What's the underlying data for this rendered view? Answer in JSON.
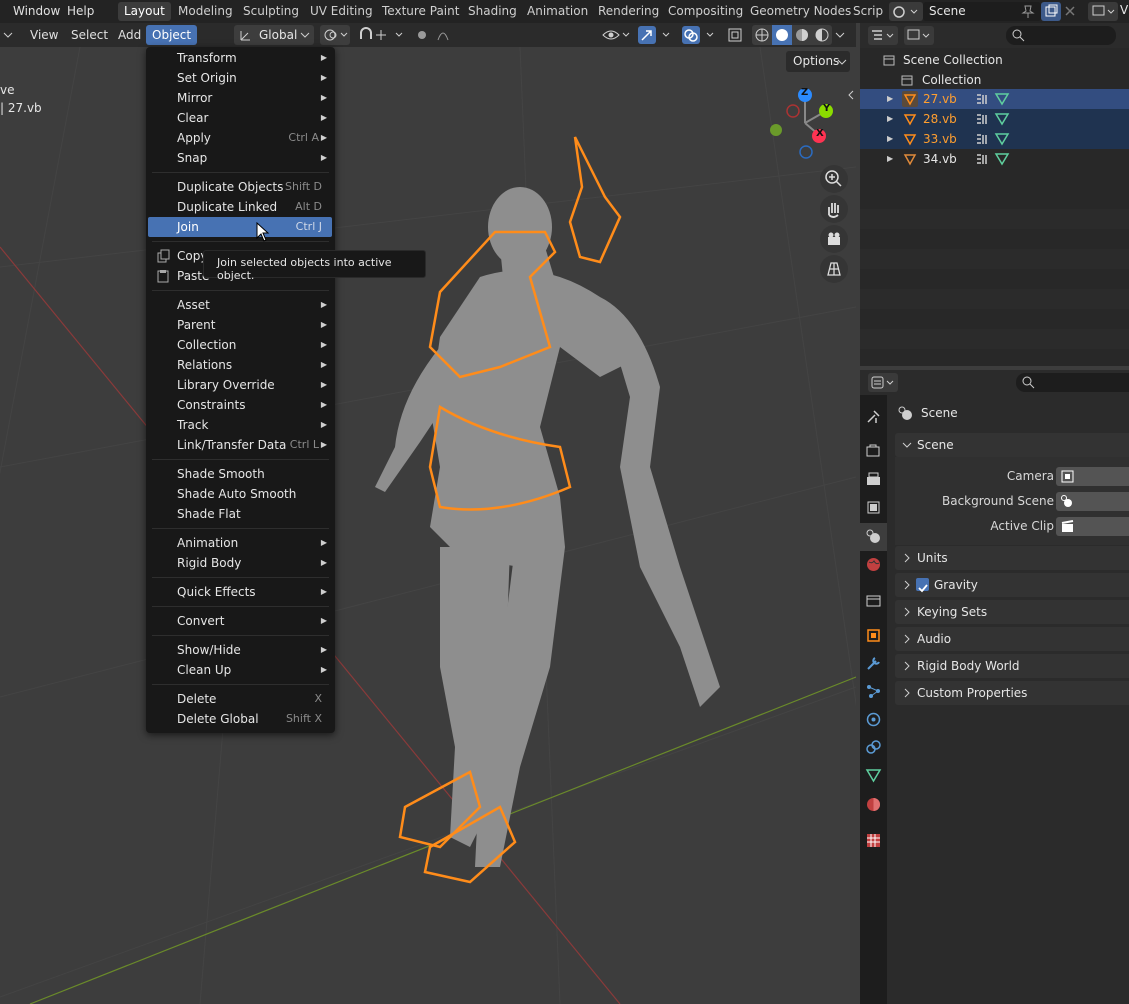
{
  "topbar": {
    "menus": [
      "Window",
      "Help"
    ],
    "workspaces": [
      "Layout",
      "Modeling",
      "Sculpting",
      "UV Editing",
      "Texture Paint",
      "Shading",
      "Animation",
      "Rendering",
      "Compositing",
      "Geometry Nodes",
      "Scrip"
    ],
    "active_workspace": "Layout",
    "scene_name": "Scene",
    "view_layer_initial": "V"
  },
  "viewport_header": {
    "menus": [
      "View",
      "Select",
      "Add",
      "Object"
    ],
    "active_menu": "Object",
    "orientation": "Global",
    "options_label": "Options"
  },
  "viewport_info": {
    "mode_text": "ve",
    "object_text": "| 27.vb"
  },
  "gizmo": {
    "z_label": "Z",
    "y_label": "Y",
    "x_label": "X"
  },
  "object_menu": {
    "items": [
      {
        "label": "Transform",
        "submenu": true
      },
      {
        "label": "Set Origin",
        "submenu": true
      },
      {
        "label": "Mirror",
        "submenu": true
      },
      {
        "label": "Clear",
        "submenu": true
      },
      {
        "label": "Apply",
        "shortcut": "Ctrl A",
        "submenu": true
      },
      {
        "label": "Snap",
        "submenu": true
      },
      {
        "label": "Duplicate Objects",
        "shortcut": "Shift D"
      },
      {
        "label": "Duplicate Linked",
        "shortcut": "Alt D"
      },
      {
        "label": "Join",
        "shortcut": "Ctrl J",
        "highlighted": true
      },
      {
        "label": "Copy"
      },
      {
        "label": "Paste"
      },
      {
        "label": "Asset",
        "submenu": true
      },
      {
        "label": "Parent",
        "submenu": true
      },
      {
        "label": "Collection",
        "submenu": true
      },
      {
        "label": "Relations",
        "submenu": true
      },
      {
        "label": "Library Override",
        "submenu": true
      },
      {
        "label": "Constraints",
        "submenu": true
      },
      {
        "label": "Track",
        "submenu": true
      },
      {
        "label": "Link/Transfer Data",
        "shortcut": "Ctrl L",
        "submenu": true
      },
      {
        "label": "Shade Smooth"
      },
      {
        "label": "Shade Auto Smooth"
      },
      {
        "label": "Shade Flat"
      },
      {
        "label": "Animation",
        "submenu": true
      },
      {
        "label": "Rigid Body",
        "submenu": true
      },
      {
        "label": "Quick Effects",
        "submenu": true
      },
      {
        "label": "Convert",
        "submenu": true
      },
      {
        "label": "Show/Hide",
        "submenu": true
      },
      {
        "label": "Clean Up",
        "submenu": true
      },
      {
        "label": "Delete",
        "shortcut": "X"
      },
      {
        "label": "Delete Global",
        "shortcut": "Shift X"
      }
    ]
  },
  "tooltip": "Join selected objects into active object.",
  "outliner": {
    "root": "Scene Collection",
    "collection": "Collection",
    "objects": [
      {
        "name": "27.vb",
        "selected": true,
        "active": true
      },
      {
        "name": "28.vb",
        "selected": true
      },
      {
        "name": "33.vb",
        "selected": true
      },
      {
        "name": "34.vb",
        "selected": false
      }
    ]
  },
  "properties": {
    "context_title": "Scene",
    "section_title": "Scene",
    "fields": [
      {
        "label": "Camera"
      },
      {
        "label": "Background Scene"
      },
      {
        "label": "Active Clip"
      }
    ],
    "panels": [
      {
        "label": "Units"
      },
      {
        "label": "Gravity",
        "checkbox": true
      },
      {
        "label": "Keying Sets"
      },
      {
        "label": "Audio"
      },
      {
        "label": "Rigid Body World"
      },
      {
        "label": "Custom Properties"
      }
    ]
  },
  "colors": {
    "accent": "#4772b3",
    "selection_orange": "#ff8c1a",
    "x_axis": "#ff3352",
    "y_axis": "#8bdc00",
    "z_axis": "#2b8bff"
  }
}
